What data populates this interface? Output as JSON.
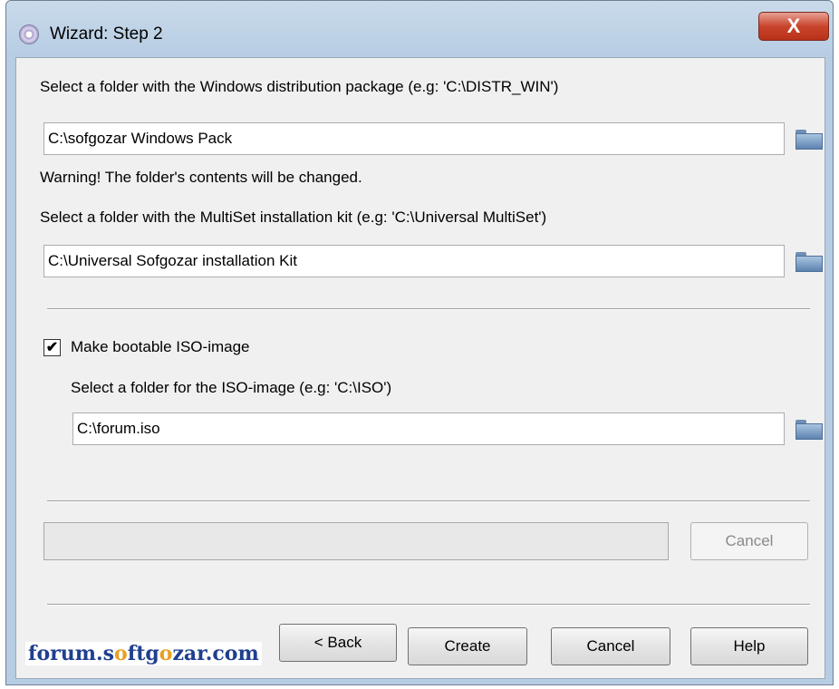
{
  "window": {
    "title": "Wizard: Step 2",
    "close_glyph": "X"
  },
  "distribution": {
    "label": "Select a folder with the Windows distribution package (e.g: 'C:\\DISTR_WIN')",
    "value": "C:\\sofgozar Windows Pack",
    "warning": "Warning! The folder's contents will be changed."
  },
  "multiset": {
    "label": "Select a folder with the MultiSet installation kit (e.g: 'C:\\Universal MultiSet')",
    "value": "C:\\Universal Sofgozar installation Kit"
  },
  "iso": {
    "checkbox_label": "Make bootable ISO-image",
    "checked": true,
    "check_glyph": "✔",
    "label": "Select a folder for the ISO-image (e.g: 'C:\\ISO')",
    "value": "C:\\forum.iso"
  },
  "progress": {
    "cancel_label": "Cancel",
    "value": 0
  },
  "buttons": {
    "back": "< Back",
    "create": "Create",
    "cancel": "Cancel",
    "help": "Help"
  },
  "watermark": {
    "part1": "forum.s",
    "part2": "o",
    "part3": "ftg",
    "part4": "o",
    "part5": "zar.com"
  },
  "icons": {
    "browse": "folder-icon",
    "app": "disc-icon"
  }
}
